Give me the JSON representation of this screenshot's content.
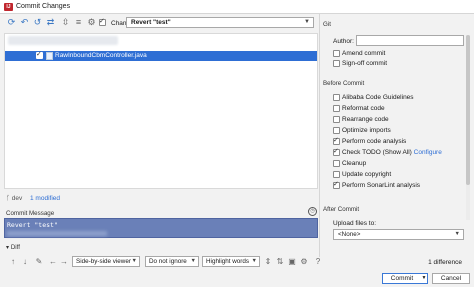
{
  "window": {
    "title": "Commit Changes",
    "app_icon": "IJ"
  },
  "toolbar": {
    "icons": [
      "refresh-icon",
      "undo-icon",
      "rollback-icon",
      "diff-icon"
    ],
    "changelist_label": "Changelist:",
    "changelist_value": "Revert \"test\""
  },
  "tree": {
    "selected_file": "RawInboundCbmController.java"
  },
  "status": {
    "branch_icon": "branch-icon",
    "branch": "dev",
    "modified": "1 modified"
  },
  "commit_message": {
    "label": "Commit Message",
    "first_line": "Revert \"test\""
  },
  "diff": {
    "label": "Diff",
    "viewer": "Side-by-side viewer",
    "ignore": "Do not ignore",
    "highlight": "Highlight words",
    "count": "1 difference"
  },
  "git": {
    "header": "Git",
    "author_label": "Author:",
    "author_value": "",
    "amend": "Amend commit",
    "signoff": "Sign-off commit"
  },
  "before_commit": {
    "header": "Before Commit",
    "options": [
      {
        "label": "Alibaba Code Guidelines",
        "checked": false
      },
      {
        "label": "Reformat code",
        "checked": false
      },
      {
        "label": "Rearrange code",
        "checked": false
      },
      {
        "label": "Optimize imports",
        "checked": false
      },
      {
        "label": "Perform code analysis",
        "checked": true
      },
      {
        "label": "Check TODO (Show All)",
        "checked": true,
        "link": "Configure"
      },
      {
        "label": "Cleanup",
        "checked": false
      },
      {
        "label": "Update copyright",
        "checked": false
      },
      {
        "label": "Perform SonarLint analysis",
        "checked": true
      }
    ]
  },
  "after_commit": {
    "header": "After Commit",
    "upload_label": "Upload files to:",
    "upload_value": "<None>"
  },
  "buttons": {
    "commit": "Commit",
    "cancel": "Cancel"
  },
  "colors": {
    "selection": "#2e6ed4",
    "accent": "#3a78d6",
    "message_bg": "#6a80b8"
  }
}
